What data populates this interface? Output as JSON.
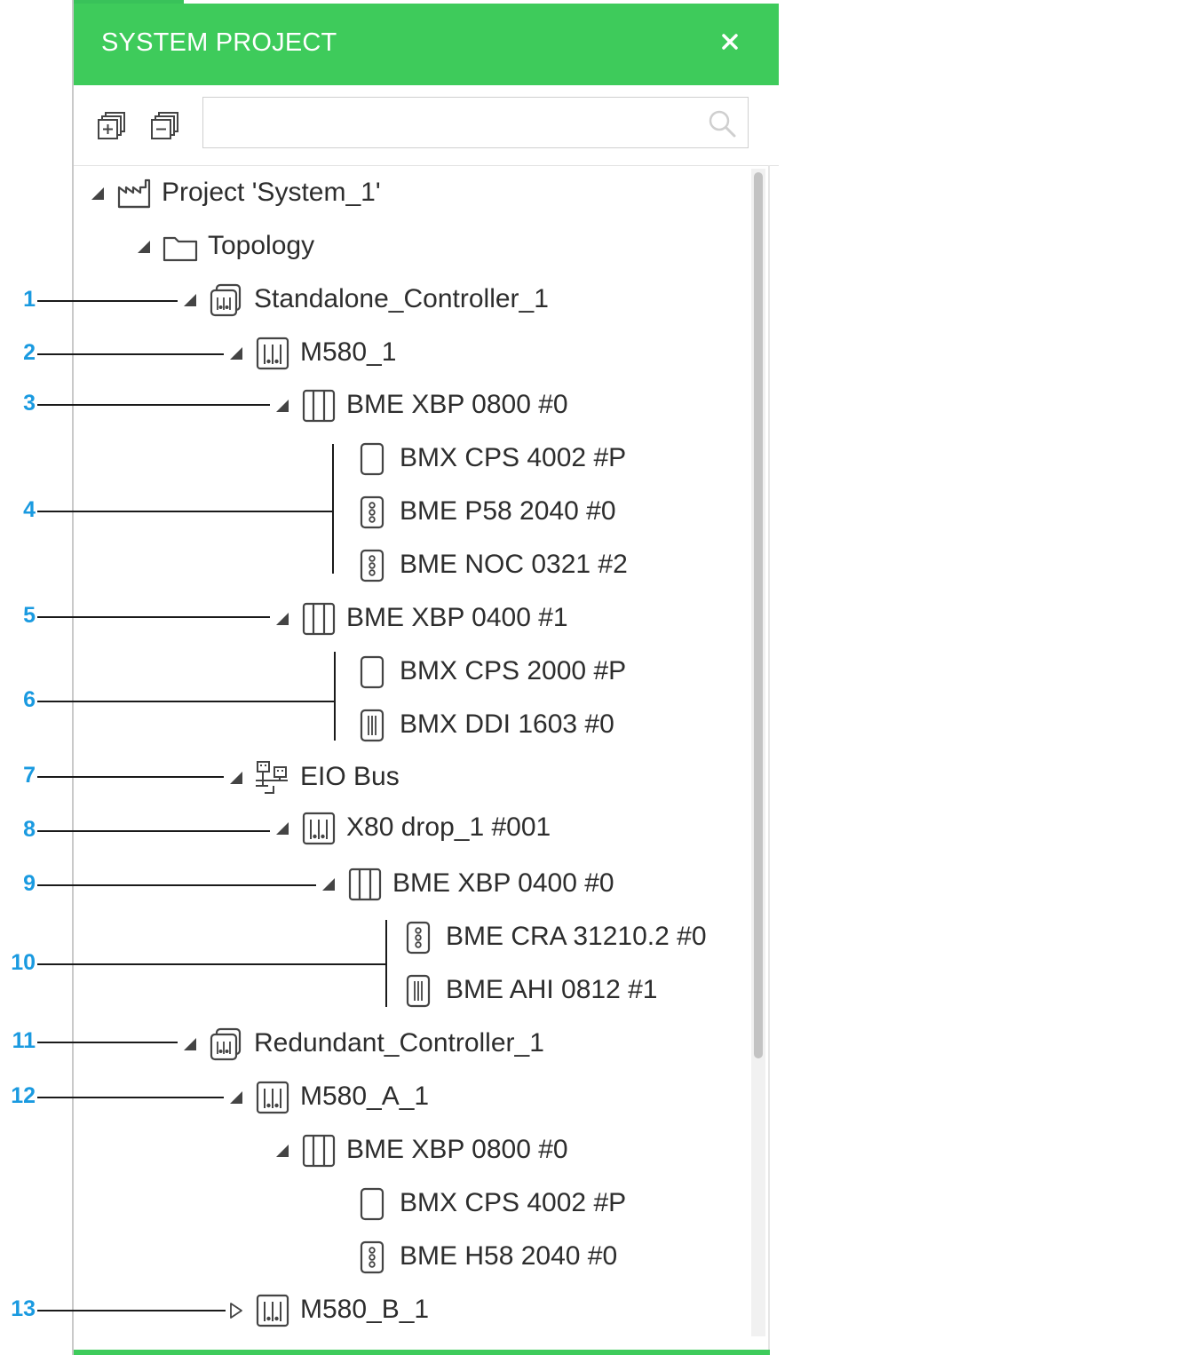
{
  "panel": {
    "title": "SYSTEM PROJECT",
    "close_icon": "close-icon",
    "expand_all_icon": "expand-all-icon",
    "collapse_all_icon": "collapse-all-icon",
    "search": {
      "value": "",
      "placeholder": ""
    },
    "colors": {
      "header": "#3ecb5b",
      "callout": "#1a9ae0"
    }
  },
  "tree": [
    {
      "label": "Project 'System_1'",
      "icon": "factory-icon",
      "expander": "expanded"
    },
    {
      "label": "Topology",
      "icon": "folder-icon",
      "expander": "expanded"
    },
    {
      "label": "Standalone_Controller_1",
      "icon": "controller-icon",
      "expander": "expanded"
    },
    {
      "label": "M580_1",
      "icon": "station-icon",
      "expander": "expanded"
    },
    {
      "label": "BME XBP 0800 #0",
      "icon": "rack-icon",
      "expander": "expanded"
    },
    {
      "label": "BMX CPS 4002 #P",
      "icon": "power-module-icon",
      "expander": "none"
    },
    {
      "label": "BME P58 2040 #0",
      "icon": "cpu-module-icon",
      "expander": "none"
    },
    {
      "label": "BME NOC 0321 #2",
      "icon": "cpu-module-icon",
      "expander": "none"
    },
    {
      "label": "BME XBP 0400 #1",
      "icon": "rack-icon",
      "expander": "expanded"
    },
    {
      "label": "BMX CPS 2000 #P",
      "icon": "power-module-icon",
      "expander": "none"
    },
    {
      "label": "BMX DDI 1603 #0",
      "icon": "io-module-icon",
      "expander": "none"
    },
    {
      "label": "EIO Bus",
      "icon": "network-bus-icon",
      "expander": "expanded"
    },
    {
      "label": "X80 drop_1 #001",
      "icon": "station-icon",
      "expander": "expanded"
    },
    {
      "label": "BME XBP 0400 #0",
      "icon": "rack-icon",
      "expander": "expanded"
    },
    {
      "label": "BME CRA 31210.2 #0",
      "icon": "cpu-module-icon",
      "expander": "none"
    },
    {
      "label": "BME AHI 0812 #1",
      "icon": "io-module-icon",
      "expander": "none"
    },
    {
      "label": "Redundant_Controller_1",
      "icon": "controller-icon",
      "expander": "expanded"
    },
    {
      "label": "M580_A_1",
      "icon": "station-icon",
      "expander": "expanded"
    },
    {
      "label": "BME XBP 0800 #0",
      "icon": "rack-icon",
      "expander": "expanded"
    },
    {
      "label": "BMX CPS 4002 #P",
      "icon": "power-module-icon",
      "expander": "none"
    },
    {
      "label": "BME H58 2040 #0",
      "icon": "cpu-module-icon",
      "expander": "none"
    },
    {
      "label": "M580_B_1",
      "icon": "station-icon",
      "expander": "collapsed"
    }
  ],
  "callouts": [
    "1",
    "2",
    "3",
    "4",
    "5",
    "6",
    "7",
    "8",
    "9",
    "10",
    "11",
    "12",
    "13"
  ]
}
